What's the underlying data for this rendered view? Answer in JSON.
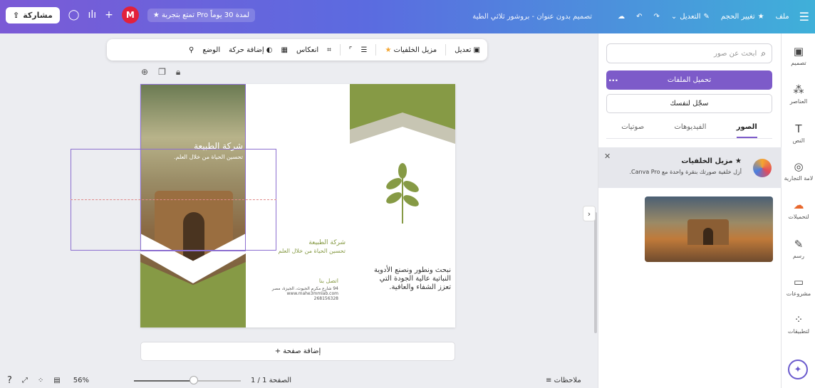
{
  "topbar": {
    "menu_icon": "hamburger-icon",
    "file_label": "ملف",
    "resize_label": "تغيير الحجم",
    "edit_label": "التعديل",
    "doc_title": "تصميم بدون عنوان - بروشور ثلاثي الطية",
    "pro_trial_label": "تمتع بتجربة Pro لمدة 30 يوماً",
    "avatar_letter": "M",
    "share_label": "مشاركة"
  },
  "toolbar": {
    "edit_label": "تعديل",
    "bg_remover_label": "مزيل الخلفيات",
    "flip_label": "انعكاس",
    "animate_label": "إضافة حركة",
    "position_label": "الوضع"
  },
  "sidebar": {
    "items": [
      {
        "label": "تصميم",
        "icon": "layout-icon"
      },
      {
        "label": "العناصر",
        "icon": "elements-icon"
      },
      {
        "label": "النص",
        "icon": "text-icon"
      },
      {
        "label": "لامة التجارية",
        "icon": "brand-icon"
      },
      {
        "label": "لتحميلات",
        "icon": "upload-icon"
      },
      {
        "label": "رسم",
        "icon": "draw-icon"
      },
      {
        "label": "مشروعات",
        "icon": "folder-icon"
      },
      {
        "label": "لتطبيقات",
        "icon": "apps-icon"
      }
    ]
  },
  "panel": {
    "search_placeholder": "ابحث عن صور",
    "upload_label": "تحميل الملفات",
    "more_label": "...",
    "record_label": "سجّل لنفسك",
    "tabs": [
      "الصور",
      "الفيديوهات",
      "صوتيات"
    ],
    "promo_title": "مزيل الخلفيات",
    "promo_text": "أزل خلفية صورتك بنقرة واحدة مع Canva Pro."
  },
  "brochure": {
    "company": "شركة الطبيعة",
    "tagline": "تحسين الحياة من خلال العلم.",
    "company2": "شركة الطبيعة",
    "tagline2": "تحسين الحياة من خلال العلم",
    "contact_title": "اتصل بنا",
    "contact_address": "94 شارع مكرم الجيوث، الجيزة، مصر",
    "contact_web": "www.mahe3mmlab.com",
    "contact_phone": "268156328",
    "headline": "نبحث ونطور ونصنع الأدوية النباتية عالية الجودة التي تعزز الشفاء والعافية."
  },
  "canvas": {
    "add_page_label": "+ إضافة صفحة"
  },
  "footer": {
    "notes_label": "ملاحظات",
    "page_label": "الصفحة 1 / 1",
    "zoom": "56%",
    "zoom_fraction": 0.56
  },
  "colors": {
    "accent": "#7d5bc9",
    "olive": "#869a45"
  }
}
